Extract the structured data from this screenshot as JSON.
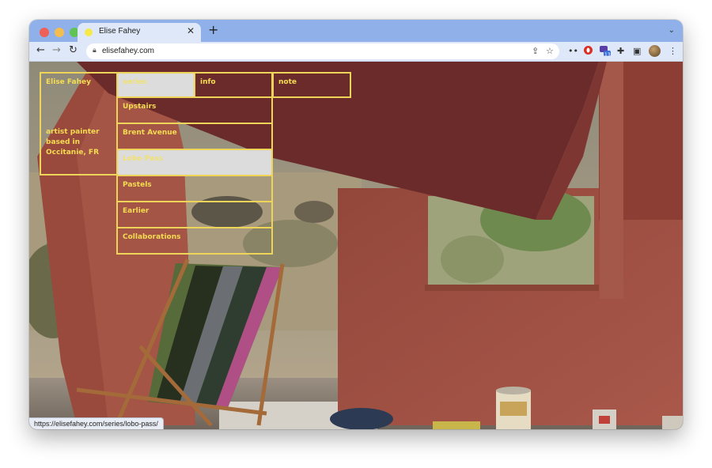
{
  "browser": {
    "tab_title": "Elise Fahey",
    "url": "elisefahey.com",
    "status_url": "https://elisefahey.com/series/lobo-pass/",
    "extension_badge": "13"
  },
  "site": {
    "name": "Elise Fahey",
    "tagline": "artist painter based in Occitanie, FR",
    "nav": {
      "series": "series",
      "info": "info",
      "note": "note"
    },
    "series": [
      "Upstairs",
      "Brent Avenue",
      "Lobo Pass",
      "Pastels",
      "Earlier",
      "Collaborations"
    ]
  },
  "colors": {
    "accent": "#f5dc52",
    "tab_bar": "#8fb0e8",
    "menu_highlight": "#dcdcdc"
  },
  "icons": [
    "back-arrow-icon",
    "forward-arrow-icon",
    "reload-icon",
    "lock-icon",
    "share-icon",
    "star-icon",
    "puzzle-icon",
    "sidebar-icon",
    "kebab-menu-icon",
    "close-icon",
    "plus-icon",
    "chevron-down-icon"
  ]
}
